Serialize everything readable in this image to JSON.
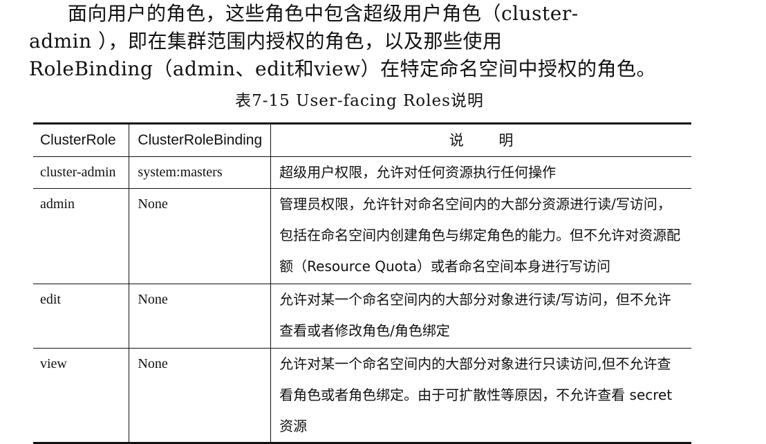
{
  "paragraph": {
    "line1": "面向用户的角色，这些角色中包含超级用户角色（cluster-",
    "line2": "admin ），即在集群范围内授权的角色，以及那些使用",
    "line3": "RoleBinding（admin、edit和view）在特定命名空间中授权的角色。"
  },
  "table_caption": "表7-15 User-facing Roles说明",
  "table": {
    "headers": {
      "cluster_role": "ClusterRole",
      "cluster_role_binding": "ClusterRoleBinding",
      "description": "说 明"
    },
    "rows": [
      {
        "cluster_role": "cluster-admin",
        "binding": "system:masters",
        "description": "超级用户权限，允许对任何资源执行任何操作"
      },
      {
        "cluster_role": "admin",
        "binding": "None",
        "description": "管理员权限，允许针对命名空间内的大部分资源进行读/写访问，包括在命名空间内创建角色与绑定角色的能力。但不允许对资源配额（Resource Quota）或者命名空间本身进行写访问"
      },
      {
        "cluster_role": "edit",
        "binding": "None",
        "description": "允许对某一个命名空间内的大部分对象进行读/写访问，但不允许查看或者修改角色/角色绑定"
      },
      {
        "cluster_role": "view",
        "binding": "None",
        "description": "允许对某一个命名空间内的大部分对象进行只读访问,但不允许查看角色或者角色绑定。由于可扩散性等原因，不允许查看 secret 资源"
      }
    ]
  }
}
